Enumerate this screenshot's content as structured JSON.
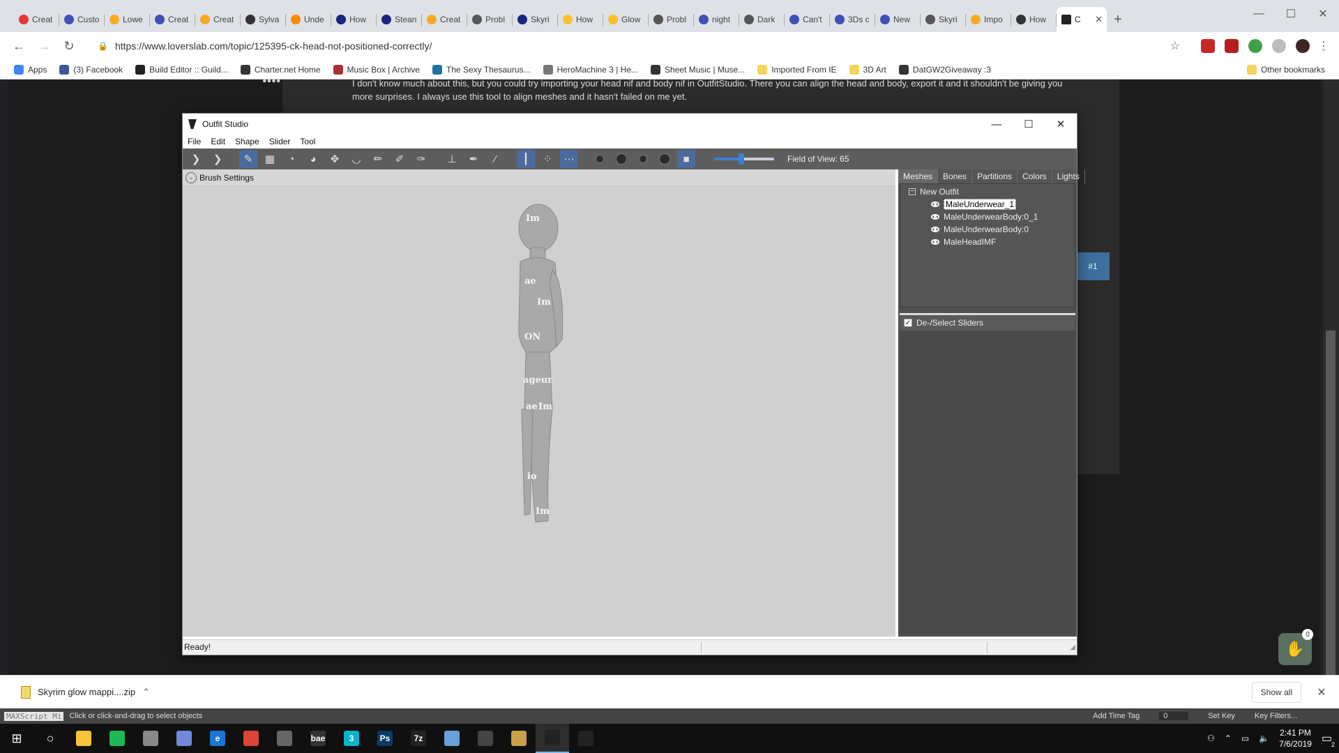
{
  "browser": {
    "tabs": [
      {
        "label": "Creat",
        "color": "#e53935"
      },
      {
        "label": "Custo",
        "color": "#3f51b5"
      },
      {
        "label": "Lowe",
        "color": "#f9a825"
      },
      {
        "label": "Creat",
        "color": "#3f51b5"
      },
      {
        "label": "Creat",
        "color": "#f9a825"
      },
      {
        "label": "Sylva",
        "color": "#333333"
      },
      {
        "label": "Unde",
        "color": "#fb8c00"
      },
      {
        "label": "How",
        "color": "#1a237e"
      },
      {
        "label": "Stean",
        "color": "#1a237e"
      },
      {
        "label": "Creat",
        "color": "#f9a825"
      },
      {
        "label": "Probl",
        "color": "#555555"
      },
      {
        "label": "Skyri",
        "color": "#1a237e"
      },
      {
        "label": "How",
        "color": "#fbc02d"
      },
      {
        "label": "Glow",
        "color": "#fbc02d"
      },
      {
        "label": "Probl",
        "color": "#555555"
      },
      {
        "label": "night",
        "color": "#3f51b5"
      },
      {
        "label": "Dark",
        "color": "#555555"
      },
      {
        "label": "Can't",
        "color": "#3f51b5"
      },
      {
        "label": "3Ds c",
        "color": "#3f51b5"
      },
      {
        "label": "New",
        "color": "#3f51b5"
      },
      {
        "label": "Skyri",
        "color": "#555555"
      },
      {
        "label": "Impo",
        "color": "#f9a825"
      },
      {
        "label": "How",
        "color": "#333333"
      }
    ],
    "active_tab": {
      "label": "C",
      "close": "✕"
    },
    "new_tab": "+",
    "url": "https://www.loverslab.com/topic/125395-ck-head-not-positioned-correctly/",
    "bookmarks": [
      {
        "label": "Apps",
        "color": "#4285f4"
      },
      {
        "label": "(3) Facebook",
        "color": "#3b5998"
      },
      {
        "label": "Build Editor :: Guild...",
        "color": "#222222"
      },
      {
        "label": "Charter.net Home",
        "color": "#333333"
      },
      {
        "label": "Music Box | Archive",
        "color": "#aa3333"
      },
      {
        "label": "The Sexy Thesaurus...",
        "color": "#21759b"
      },
      {
        "label": "HeroMachine 3 | He...",
        "color": "#777777"
      },
      {
        "label": "Sheet Music | Muse...",
        "color": "#333333"
      },
      {
        "label": "Imported From IE",
        "color": "#f4d35e"
      },
      {
        "label": "3D Art",
        "color": "#f4d35e"
      },
      {
        "label": "DatGW2Giveaway :3",
        "color": "#333333"
      }
    ],
    "other_bookmarks": "Other bookmarks"
  },
  "webpage": {
    "rank": "●●●●",
    "post_text": "I don't know much about this, but you could try importing your head nif and body nif in OutfitStudio. There you can align the head and body, export it and it shouldn't be giving you more surprises. I always use this tool to align meshes and it hasn't failed on me yet.",
    "like_label": "#1",
    "notif_count": "0"
  },
  "outfit_studio": {
    "title": "Outfit Studio",
    "menu": [
      "File",
      "Edit",
      "Shape",
      "Slider",
      "Tool"
    ],
    "field_of_view": "Field of View: 65",
    "fov_slider": 0.45,
    "brush_settings": "Brush Settings",
    "panel_tabs": [
      "Meshes",
      "Bones",
      "Partitions",
      "Colors",
      "Lights"
    ],
    "tree_root": "New Outfit",
    "meshes": [
      "MaleUnderwear_1",
      "MaleUnderwearBody:0_1",
      "MaleUnderwearBody:0",
      "MaleHeadIMF"
    ],
    "sliders_header": "De-/Select Sliders",
    "status": "Ready!"
  },
  "download_shelf": {
    "file": "Skyrim glow mappi....zip",
    "show_all": "Show all"
  },
  "max_status": {
    "script_label": "MAXScript Mi",
    "prompt": "Click or click-and-drag to select objects",
    "add_time_tag": "Add Time Tag",
    "frame": "0",
    "set_key": "Set Key",
    "key_filters": "Key Filters..."
  },
  "taskbar": {
    "apps": [
      {
        "label": "",
        "color": "#f9c23c"
      },
      {
        "label": "",
        "color": "#1db954"
      },
      {
        "label": "",
        "color": "#888888"
      },
      {
        "label": "",
        "color": "#7289da"
      },
      {
        "label": "e",
        "color": "#1976d2"
      },
      {
        "label": "",
        "color": "#db4437"
      },
      {
        "label": "",
        "color": "#666666"
      },
      {
        "label": "bae",
        "color": "#333333"
      },
      {
        "label": "3",
        "color": "#0ab3c9"
      },
      {
        "label": "Ps",
        "color": "#0b3a66"
      },
      {
        "label": "7z",
        "color": "#222222"
      },
      {
        "label": "",
        "color": "#6aa0d8"
      },
      {
        "label": "",
        "color": "#444444"
      },
      {
        "label": "",
        "color": "#c9a14b"
      },
      {
        "label": "",
        "color": "#222222"
      },
      {
        "label": "",
        "color": "#222222"
      }
    ],
    "time": "2:41 PM",
    "date": "7/6/2019",
    "notifications": "2"
  }
}
